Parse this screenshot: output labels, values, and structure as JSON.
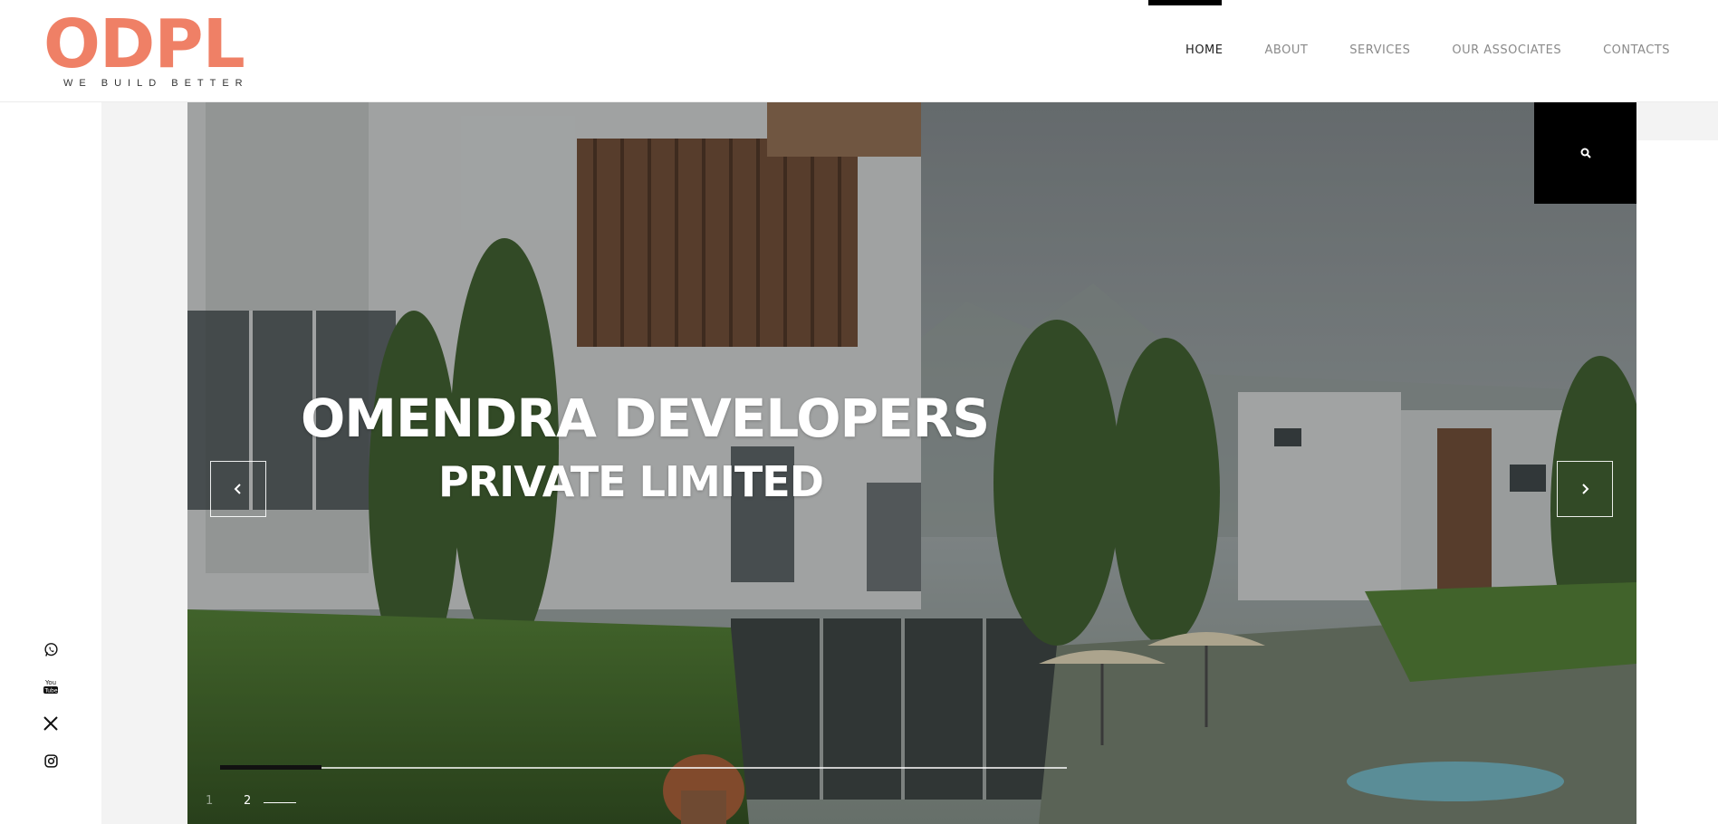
{
  "brand": {
    "logo_text": "ODPL",
    "tagline": "WE BUILD BETTER",
    "accent_color": "#ef8066"
  },
  "nav": {
    "items": [
      {
        "label": "HOME",
        "active": true
      },
      {
        "label": "ABOUT",
        "active": false
      },
      {
        "label": "SERVICES",
        "active": false
      },
      {
        "label": "OUR ASSOCIATES",
        "active": false
      },
      {
        "label": "CONTACTS",
        "active": false
      }
    ]
  },
  "hero": {
    "title": "OMENDRA DEVELOPERS",
    "subtitle": "PRIVATE LIMITED",
    "prev_icon": "chevron-left-icon",
    "next_icon": "chevron-right-icon",
    "search_icon": "search-icon",
    "pagination": {
      "page_1": "1",
      "page_2": "2",
      "current": 2
    },
    "progress": 0.12
  },
  "social": {
    "icons": [
      "whatsapp-icon",
      "youtube-icon",
      "x-twitter-icon",
      "instagram-icon"
    ],
    "youtube_glyph": "You\nTube"
  }
}
